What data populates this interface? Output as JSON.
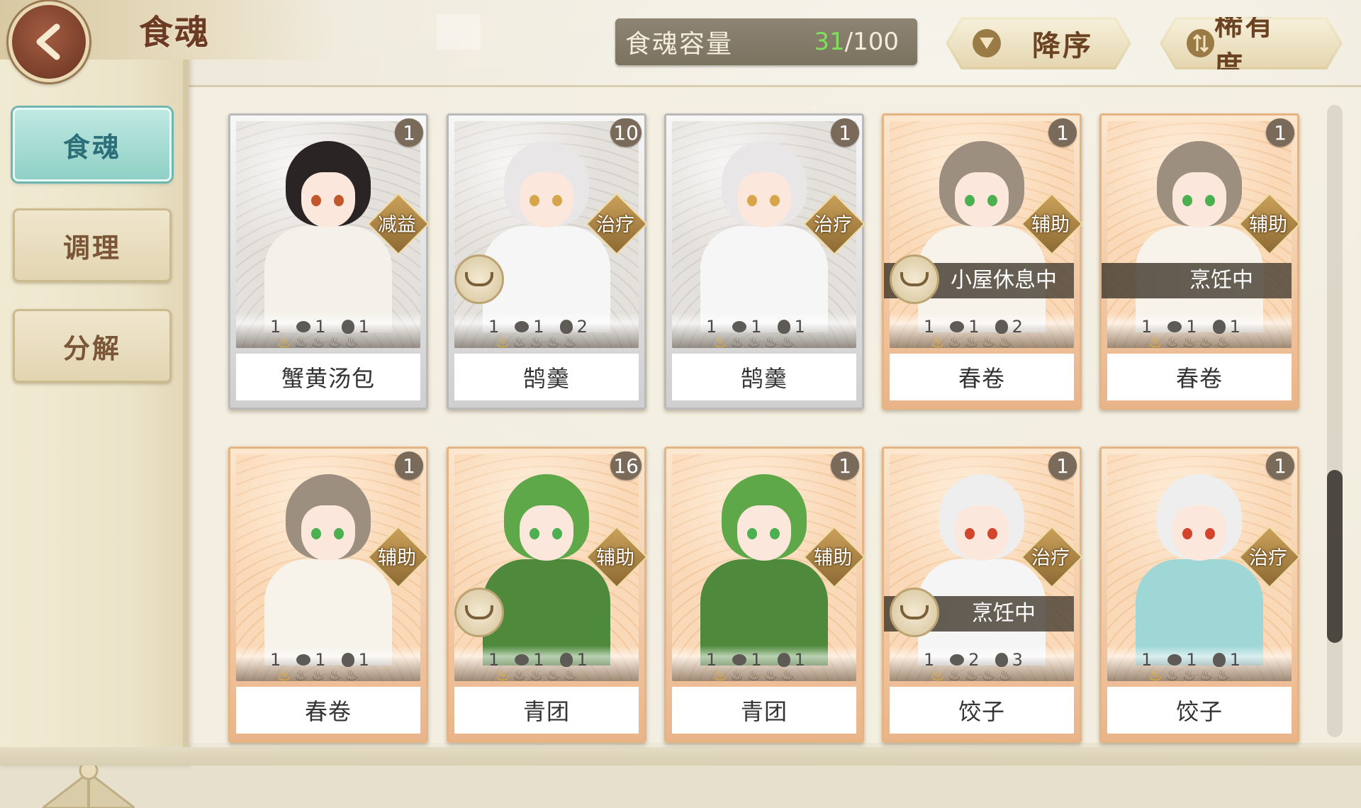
{
  "header": {
    "title": "食魂",
    "capacity_label": "食魂容量",
    "capacity_current": "31",
    "capacity_max": "/100",
    "sort_order_label": "降序",
    "sort_field_label": "稀有度"
  },
  "sidebar": {
    "tabs": [
      {
        "label": "食魂",
        "active": true
      },
      {
        "label": "调理",
        "active": false
      },
      {
        "label": "分解",
        "active": false
      }
    ]
  },
  "cards": [
    {
      "name": "蟹黄汤包",
      "count": "1",
      "role": "减益",
      "frame": "silver",
      "status": "",
      "resting": false,
      "stats": [
        "1",
        "1",
        "1"
      ],
      "stars_on": 1,
      "palette": {
        "hair": "#2a2424",
        "eye": "#c2582a",
        "body": "#f4f1ea"
      }
    },
    {
      "name": "鹄羹",
      "count": "10",
      "role": "治疗",
      "frame": "silver",
      "status": "",
      "resting": true,
      "stats": [
        "1",
        "1",
        "2"
      ],
      "stars_on": 1,
      "palette": {
        "hair": "#e9e6e8",
        "eye": "#d7a54a",
        "body": "#f6f6f6"
      }
    },
    {
      "name": "鹄羹",
      "count": "1",
      "role": "治疗",
      "frame": "silver",
      "status": "",
      "resting": false,
      "stats": [
        "1",
        "1",
        "1"
      ],
      "stars_on": 1,
      "palette": {
        "hair": "#e9e6e8",
        "eye": "#d7a54a",
        "body": "#f6f6f6"
      }
    },
    {
      "name": "春卷",
      "count": "1",
      "role": "辅助",
      "frame": "orange",
      "status": "小屋休息中",
      "resting": true,
      "stats": [
        "1",
        "1",
        "2"
      ],
      "stars_on": 1,
      "palette": {
        "hair": "#9c8f7f",
        "eye": "#4caf50",
        "body": "#f7f2ea"
      }
    },
    {
      "name": "春卷",
      "count": "1",
      "role": "辅助",
      "frame": "orange",
      "status": "烹饪中",
      "resting": false,
      "stats": [
        "1",
        "1",
        "1"
      ],
      "stars_on": 1,
      "palette": {
        "hair": "#9c8f7f",
        "eye": "#4caf50",
        "body": "#f7f2ea"
      }
    },
    {
      "name": "春卷",
      "count": "1",
      "role": "辅助",
      "frame": "orange",
      "status": "",
      "resting": false,
      "stats": [
        "1",
        "1",
        "1"
      ],
      "stars_on": 1,
      "palette": {
        "hair": "#9c8f7f",
        "eye": "#4caf50",
        "body": "#f7f2ea"
      }
    },
    {
      "name": "青团",
      "count": "16",
      "role": "辅助",
      "frame": "orange",
      "status": "",
      "resting": true,
      "stats": [
        "1",
        "1",
        "1"
      ],
      "stars_on": 1,
      "palette": {
        "hair": "#5fa84a",
        "eye": "#4caf50",
        "body": "#4f8a3c"
      }
    },
    {
      "name": "青团",
      "count": "1",
      "role": "辅助",
      "frame": "orange",
      "status": "",
      "resting": false,
      "stats": [
        "1",
        "1",
        "1"
      ],
      "stars_on": 1,
      "palette": {
        "hair": "#5fa84a",
        "eye": "#4caf50",
        "body": "#4f8a3c"
      }
    },
    {
      "name": "饺子",
      "count": "1",
      "role": "治疗",
      "frame": "orange",
      "status": "烹饪中",
      "resting": true,
      "stats": [
        "1",
        "2",
        "3"
      ],
      "stars_on": 1,
      "palette": {
        "hair": "#eeeeee",
        "eye": "#d2452b",
        "body": "#f5f5f5"
      }
    },
    {
      "name": "饺子",
      "count": "1",
      "role": "治疗",
      "frame": "orange",
      "status": "",
      "resting": false,
      "stats": [
        "1",
        "1",
        "1"
      ],
      "stars_on": 1,
      "palette": {
        "hair": "#eeeeee",
        "eye": "#d2452b",
        "body": "#9fd6d6"
      }
    }
  ],
  "icons": {
    "back": "chevron-left-icon",
    "sort_order": "triangle-down-icon",
    "sort_field": "swap-vertical-icon",
    "rest": "bowl-icon",
    "stat1": "seed-icon",
    "stat2": "flame-drop-icon",
    "star": "flame-icon"
  },
  "colors": {
    "capacity_current": "#7ee05a",
    "active_tab": "#8fd0c6",
    "silver_frame": "#b9b9b9",
    "orange_frame": "#e6b483"
  },
  "scroll": {
    "position": 0.58,
    "visible_fraction": 0.27
  }
}
